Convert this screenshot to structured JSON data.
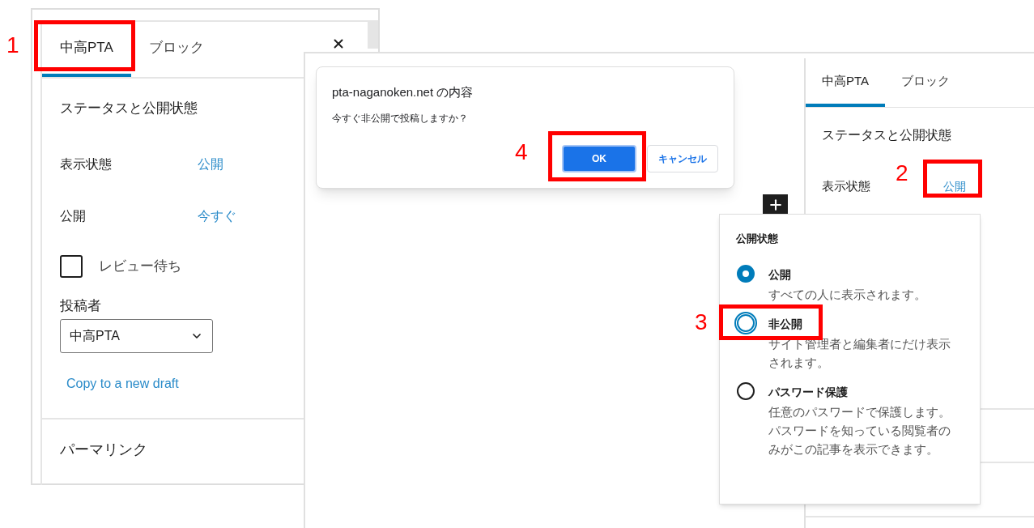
{
  "left_panel": {
    "tabs": [
      {
        "label": "中高PTA",
        "selected": true
      },
      {
        "label": "ブロック",
        "selected": false
      }
    ],
    "section_title": "ステータスと公開状態",
    "rows": [
      {
        "label": "表示状態",
        "value": "公開"
      },
      {
        "label": "公開",
        "value": "今すぐ"
      }
    ],
    "review": {
      "label": "レビュー待ち",
      "checked": false
    },
    "author": {
      "label": "投稿者",
      "value": "中高PTA"
    },
    "copy_link": "Copy to a new draft",
    "permalink": "パーマリンク"
  },
  "dialog": {
    "title": "pta-naganoken.net の内容",
    "message": "今すぐ非公開で投稿しますか？",
    "buttons": [
      {
        "label": "OK",
        "kind": "primary"
      },
      {
        "label": "キャンセル",
        "kind": "secondary"
      }
    ]
  },
  "right_panel": {
    "tabs": [
      {
        "label": "中高PTA",
        "selected": true
      },
      {
        "label": "ブロック",
        "selected": false
      }
    ],
    "section_title": "ステータスと公開状態",
    "rows": [
      {
        "label": "表示状態",
        "value": "公開"
      }
    ]
  },
  "visibility_popover": {
    "title": "公開状態",
    "options": [
      {
        "label": "公開",
        "description": "すべての人に表示されます。",
        "selected": true,
        "focused": false
      },
      {
        "label": "非公開",
        "description": "サイト管理者と編集者にだけ表示されます。",
        "selected": false,
        "focused": true
      },
      {
        "label": "パスワード保護",
        "description": "任意のパスワードで保護します。パスワードを知っている閲覧者のみがこの記事を表示できます。",
        "selected": false,
        "focused": false
      }
    ]
  },
  "annotations": [
    "1",
    "2",
    "3",
    "4"
  ]
}
